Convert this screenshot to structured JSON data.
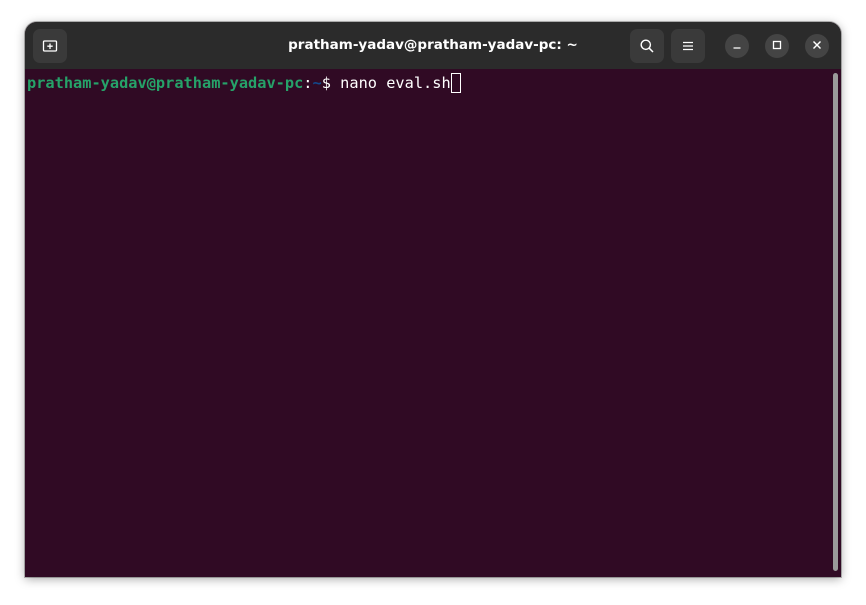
{
  "window": {
    "title": "pratham-yadav@pratham-yadav-pc: ~"
  },
  "titlebar": {
    "new_tab_icon": "new-tab-icon",
    "search_icon": "search-icon",
    "menu_icon": "hamburger-menu-icon",
    "minimize_icon": "minimize-icon",
    "maximize_icon": "maximize-icon",
    "close_icon": "close-icon"
  },
  "terminal": {
    "prompt_user": "pratham-yadav@pratham-yadav-pc",
    "prompt_colon": ":",
    "prompt_path": "~",
    "prompt_symbol": "$ ",
    "command": "nano eval.sh",
    "colors": {
      "background": "#300a24",
      "user": "#26a269",
      "path": "#12488b",
      "text": "#ffffff"
    }
  }
}
